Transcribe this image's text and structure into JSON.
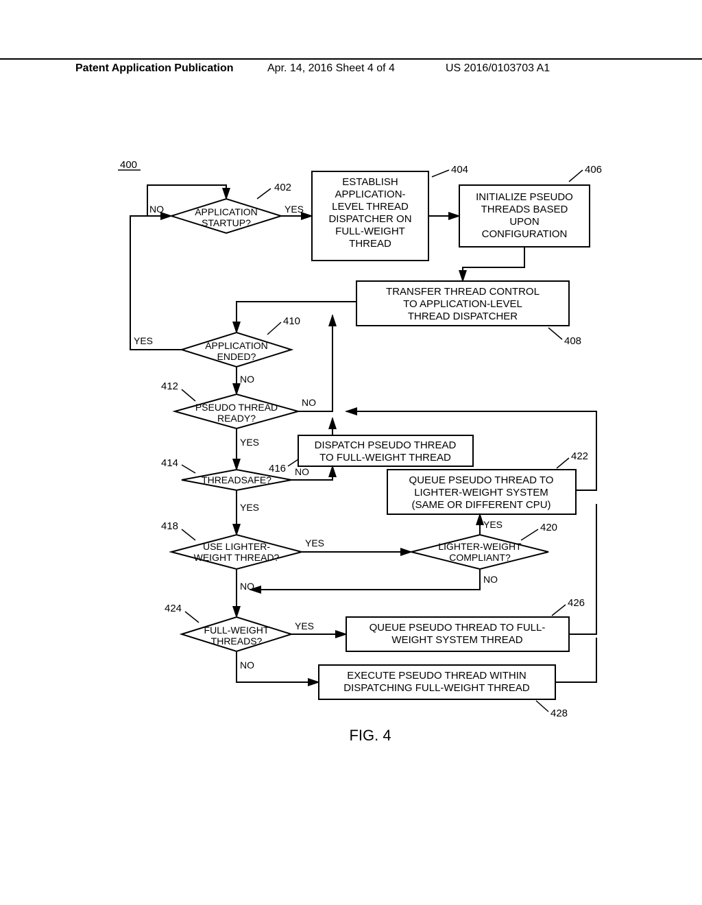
{
  "header": {
    "left": "Patent Application Publication",
    "mid": "Apr. 14, 2016  Sheet 4 of 4",
    "right": "US 2016/0103703 A1"
  },
  "figure_label": "FIG. 4",
  "ref_400": "400",
  "labels": {
    "yes": "YES",
    "no": "NO"
  },
  "nodes": {
    "n402": {
      "ref": "402",
      "l1": "APPLICATION",
      "l2": "STARTUP?"
    },
    "n404": {
      "ref": "404",
      "l1": "ESTABLISH",
      "l2": "APPLICATION-",
      "l3": "LEVEL THREAD",
      "l4": "DISPATCHER ON",
      "l5": "FULL-WEIGHT",
      "l6": "THREAD"
    },
    "n406": {
      "ref": "406",
      "l1": "INITIALIZE PSEUDO",
      "l2": "THREADS BASED",
      "l3": "UPON",
      "l4": "CONFIGURATION"
    },
    "n408": {
      "ref": "408",
      "l1": "TRANSFER THREAD CONTROL",
      "l2": "TO APPLICATION-LEVEL",
      "l3": "THREAD DISPATCHER"
    },
    "n410": {
      "ref": "410",
      "l1": "APPLICATION",
      "l2": "ENDED?"
    },
    "n412": {
      "ref": "412",
      "l1": "PSEUDO THREAD",
      "l2": "READY?"
    },
    "n414": {
      "ref": "414",
      "l1": "THREADSAFE?"
    },
    "n416": {
      "ref": "416",
      "l1": "DISPATCH PSEUDO THREAD",
      "l2": "TO FULL-WEIGHT THREAD"
    },
    "n418": {
      "ref": "418",
      "l1": "USE LIGHTER-",
      "l2": "WEIGHT THREAD?"
    },
    "n420": {
      "ref": "420",
      "l1": "LIGHTER-WEIGHT",
      "l2": "COMPLIANT?"
    },
    "n422": {
      "ref": "422",
      "l1": "QUEUE PSEUDO THREAD TO",
      "l2": "LIGHTER-WEIGHT SYSTEM",
      "l3": "(SAME OR DIFFERENT CPU)"
    },
    "n424": {
      "ref": "424",
      "l1": "FULL-WEIGHT",
      "l2": "THREADS?"
    },
    "n426": {
      "ref": "426",
      "l1": "QUEUE PSEUDO THREAD TO FULL-",
      "l2": "WEIGHT SYSTEM THREAD"
    },
    "n428": {
      "ref": "428",
      "l1": "EXECUTE PSEUDO THREAD WITHIN",
      "l2": "DISPATCHING FULL-WEIGHT THREAD"
    }
  }
}
